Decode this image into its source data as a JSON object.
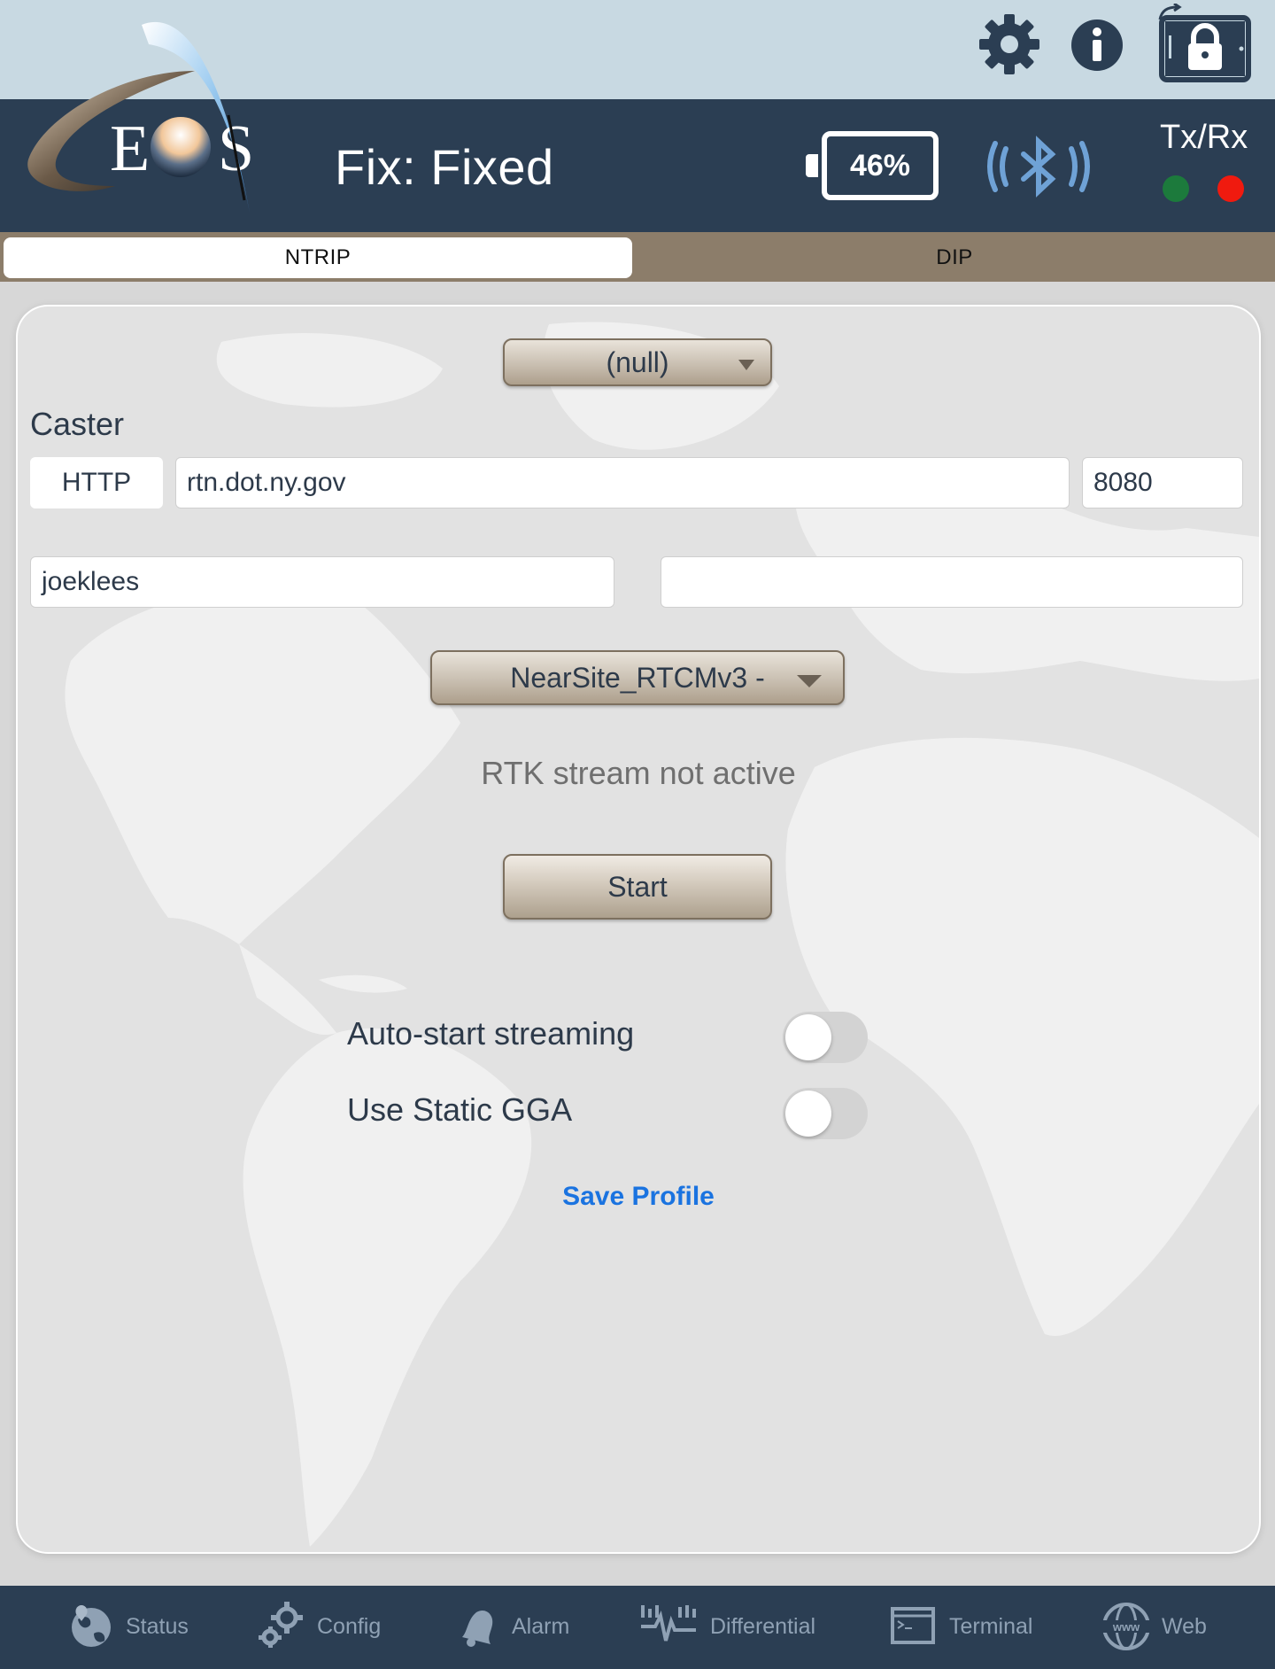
{
  "header": {
    "logo_text": "EOS",
    "fix_status": "Fix: Fixed",
    "battery_percent": "46%",
    "txrx_label": "Tx/Rx",
    "tx_led_color": "#1c7a3c",
    "rx_led_color": "#f01a0f"
  },
  "top_icons": [
    "gear-icon",
    "info-icon",
    "lock-icon"
  ],
  "tabs": [
    {
      "label": "NTRIP",
      "active": true
    },
    {
      "label": "DIP",
      "active": false
    }
  ],
  "ntrip": {
    "profile_select": "(null)",
    "caster_label": "Caster",
    "protocol": "HTTP",
    "host": "rtn.dot.ny.gov",
    "port": "8080",
    "username": "joeklees",
    "password": "",
    "mountpoint_select": "NearSite_RTCMv3 -",
    "stream_status": "RTK stream not active",
    "start_label": "Start",
    "toggles": [
      {
        "label": "Auto-start streaming",
        "on": false
      },
      {
        "label": "Use Static GGA",
        "on": false
      }
    ],
    "save_label": "Save Profile"
  },
  "bottom_nav": [
    {
      "label": "Status",
      "icon": "globe-icon"
    },
    {
      "label": "Config",
      "icon": "gears-icon"
    },
    {
      "label": "Alarm",
      "icon": "bell-icon"
    },
    {
      "label": "Differential",
      "icon": "waveform-icon"
    },
    {
      "label": "Terminal",
      "icon": "terminal-icon"
    },
    {
      "label": "Web",
      "icon": "www-icon"
    }
  ],
  "colors": {
    "header_bg": "#2b3e53",
    "top_bg": "#c8d9e2",
    "tab_bar_bg": "#8c7d6a",
    "link_blue": "#1a73e0"
  }
}
